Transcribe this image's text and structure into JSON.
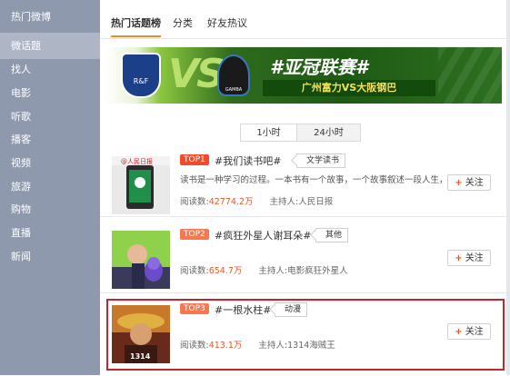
{
  "sidebar": {
    "items": [
      {
        "label": "热门微博"
      },
      {
        "label": "微话题"
      },
      {
        "label": "找人"
      },
      {
        "label": "电影"
      },
      {
        "label": "听歌"
      },
      {
        "label": "播客"
      },
      {
        "label": "视频"
      },
      {
        "label": "旅游"
      },
      {
        "label": "购物"
      },
      {
        "label": "直播"
      },
      {
        "label": "新闻"
      }
    ],
    "active_index": 1
  },
  "tabs": [
    {
      "label": "热门话题榜"
    },
    {
      "label": "分类"
    },
    {
      "label": "好友热议"
    }
  ],
  "banner": {
    "vs": "VS",
    "title": "#亚冠联赛#",
    "subtitle": "广州富力VS大阪钢巴",
    "logo_left": "R&F",
    "logo_right": "GAMBA OSAKA"
  },
  "time_toggle": {
    "options": [
      "1小时",
      "24小时"
    ],
    "selected": "1小时"
  },
  "topics": [
    {
      "rank": "TOP1",
      "title": "#我们读书吧#",
      "category": "文学读书",
      "description": "读书是一种学习的过程。一本书有一个故事，一个故事叙述一段人生，一...",
      "reads_label": "阅读数:",
      "reads": "42774.2万",
      "host_label": "主持人:",
      "host": "人民日报",
      "thumb_text": "@人民日报",
      "follow_label": "关注"
    },
    {
      "rank": "TOP2",
      "title": "#疯狂外星人谢耳朵#",
      "category": "其他",
      "description": "",
      "reads_label": "阅读数:",
      "reads": "654.7万",
      "host_label": "主持人:",
      "host": "电影疯狂外星人",
      "follow_label": "关注"
    },
    {
      "rank": "TOP3",
      "title": "#一根水柱#",
      "category": "动漫",
      "description": "",
      "reads_label": "阅读数:",
      "reads": "413.1万",
      "host_label": "主持人:",
      "host": "1314海贼王",
      "thumb_text": "1314",
      "follow_label": "关注"
    }
  ],
  "colors": {
    "sidebar_bg": "#8f99ad",
    "accent_orange": "#f08a28",
    "rank_bg": "#f57850",
    "highlight_border": "#c0262d",
    "read_count": "#e05a2a"
  }
}
